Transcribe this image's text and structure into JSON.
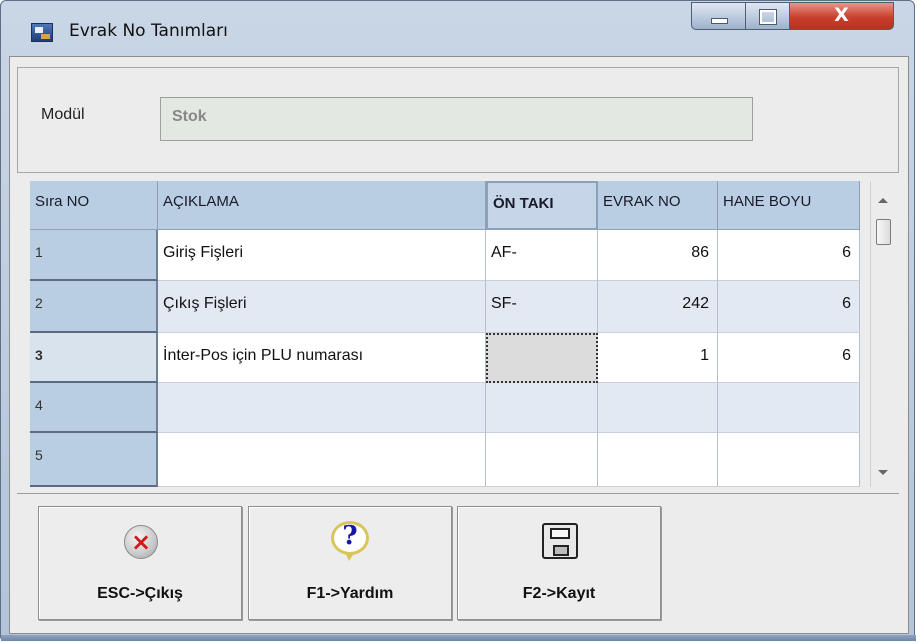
{
  "window": {
    "title": "Evrak No Tanımları",
    "minimize_glyph": "",
    "maximize_glyph": "",
    "close_glyph": "X"
  },
  "module": {
    "label": "Modül",
    "value": "Stok"
  },
  "grid": {
    "headers": [
      "Sıra NO",
      "AÇIKLAMA",
      "ÖN TAKI",
      "EVRAK NO",
      "HANE BOYU"
    ],
    "rows": [
      {
        "no": "1",
        "aciklama": "Giriş Fişleri",
        "on_taki": "AF-",
        "evrak_no": "86",
        "hane_boyu": "6"
      },
      {
        "no": "2",
        "aciklama": "Çıkış Fişleri",
        "on_taki": "SF-",
        "evrak_no": "242",
        "hane_boyu": "6"
      },
      {
        "no": "3",
        "aciklama": "İnter-Pos için PLU numarası",
        "on_taki": "",
        "evrak_no": "1",
        "hane_boyu": "6"
      },
      {
        "no": "4",
        "aciklama": "",
        "on_taki": "",
        "evrak_no": "",
        "hane_boyu": ""
      },
      {
        "no": "5",
        "aciklama": "",
        "on_taki": "",
        "evrak_no": "",
        "hane_boyu": ""
      }
    ]
  },
  "buttons": {
    "esc": "ESC->Çıkış",
    "help": "F1->Yardım",
    "save": "F2->Kayıt"
  },
  "icons": {
    "app": "form-icon",
    "esc": "close-circle-icon",
    "help": "help-bubble-icon",
    "save": "floppy-disk-icon"
  },
  "colors": {
    "header_bg": "#b9cee3",
    "even_row_bg": "#e3e9f3",
    "close_button": "#c8402d"
  }
}
